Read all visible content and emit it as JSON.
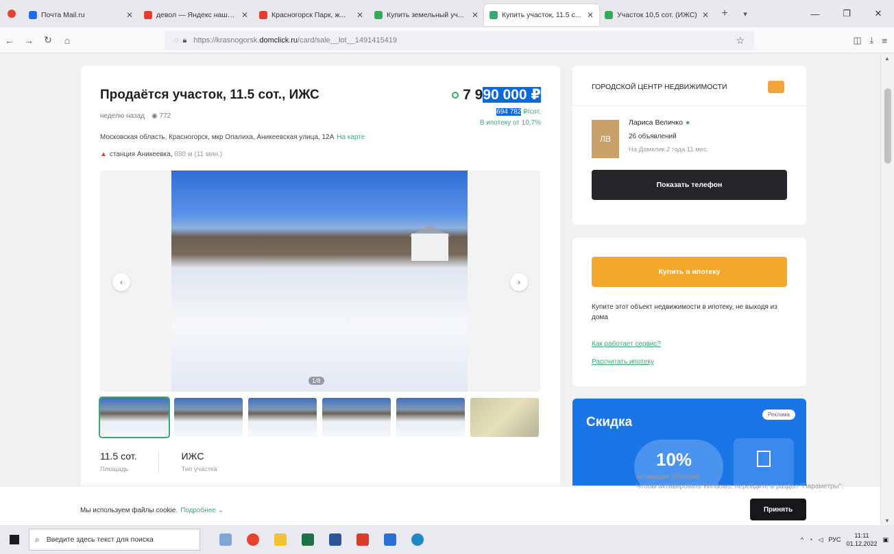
{
  "browser": {
    "tabs": [
      {
        "title": "Почта Mail.ru",
        "color": "#1e6cf0",
        "active": false
      },
      {
        "title": "девол — Яндекс нашлось",
        "color": "#e23d2d",
        "active": false
      },
      {
        "title": "Красногорск Парк, ж...",
        "color": "#e23d2d",
        "active": false
      },
      {
        "title": "Купить земельный уч...",
        "color": "#35a85a",
        "active": false
      },
      {
        "title": "Купить участок, 11.5 с...",
        "color": "#3aa876",
        "active": true
      },
      {
        "title": "Участок 10,5 сот. (ИЖС)",
        "color": "#35a85a",
        "active": false
      }
    ],
    "new_tab": "+",
    "url_prefix": "https://krasnogorsk.",
    "url_domain": "domclick.ru",
    "url_path": "/card/sale__lot__1491415419"
  },
  "listing": {
    "title": "Продаётся участок, 11.5 сот., ИЖС",
    "posted": "неделю назад",
    "views": "772",
    "price_start": "7 9",
    "price_selected": "90 000 ₽",
    "price_per_sotka_selected": "694 782",
    "price_per_sotka_unit": " ₽/сот.",
    "mortgage_from": "В ипотеку от 10,7%",
    "address": "Московская область, Красногорск, мкр Опалиха, Аникеевская улица, 12А",
    "address_map_link": "На карте",
    "metro_station": "станция Аникеевка,",
    "metro_distance": "880 м (11 мин.)",
    "photo_counter": "1/8",
    "facts": [
      {
        "value": "11.5 сот.",
        "label": "Площадь"
      },
      {
        "value": "ИЖС",
        "label": "Тип участка"
      }
    ]
  },
  "seller": {
    "agency": "ГОРОДСКОЙ ЦЕНТР НЕДВИЖИМОСТИ",
    "avatar_initials": "ЛВ",
    "name": "Лариса Величко",
    "ads_count": "26 объявлений",
    "since": "На Домклик 2 года 11 мес.",
    "phone_button": "Показать телефон"
  },
  "mortgage": {
    "button": "Купить в ипотеку",
    "text": "Купите этот объект недвижимости в ипотеку, не выходя из дома",
    "link_how": "Как работает сервис?",
    "link_calc": "Рассчитать ипотеку"
  },
  "ad": {
    "title": "Скидка",
    "badge": "Реклама",
    "percent": "10%"
  },
  "cookie": {
    "text": "Мы используем файлы cookie.",
    "more_link": "Подробнее",
    "accept": "Принять"
  },
  "windows_activation": {
    "line1": "Активация Windows",
    "line2": "Чтобы активировать Windows, перейдите в раздел \"Параметры\"."
  },
  "taskbar": {
    "search_placeholder": "Введите здесь текст для поиска",
    "lang": "РУС",
    "time": "11:11",
    "date": "01.12.2022"
  }
}
